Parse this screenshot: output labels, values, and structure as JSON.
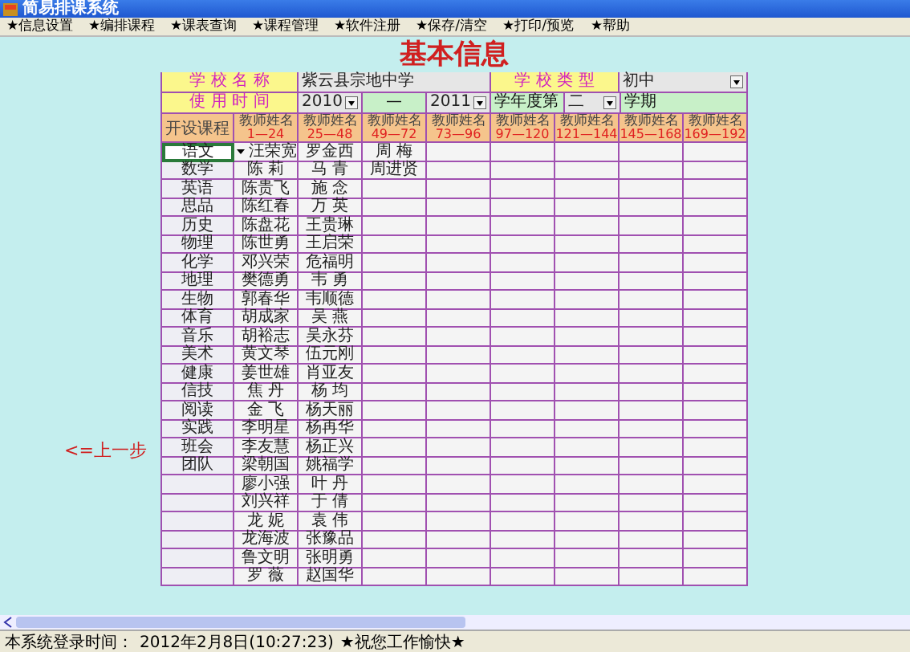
{
  "window": {
    "title": "简易排课系统"
  },
  "menu": [
    "★信息设置",
    "★编排课程",
    "★课表查询",
    "★课程管理",
    "★软件注册",
    "★保存/清空",
    "★打印/预览",
    "★帮助"
  ],
  "heading": "基本信息",
  "school": {
    "name_label": "学 校 名 称",
    "name": "紫云县宗地中学",
    "type_label": "学 校 类 型",
    "type": "初中"
  },
  "period": {
    "label": "使用时间",
    "start_year": "2010",
    "dash": "—",
    "end_year": "2011",
    "term_prefix": "学年度第",
    "term": "二",
    "term_suffix": "学期"
  },
  "table": {
    "subject_header": "开设课程",
    "columns": [
      {
        "label": "教师姓名",
        "range": "1—24"
      },
      {
        "label": "教师姓名",
        "range": "25—48"
      },
      {
        "label": "教师姓名",
        "range": "49—72"
      },
      {
        "label": "教师姓名",
        "range": "73—96"
      },
      {
        "label": "教师姓名",
        "range": "97—120"
      },
      {
        "label": "教师姓名",
        "range": "121—144"
      },
      {
        "label": "教师姓名",
        "range": "145—168"
      },
      {
        "label": "教师姓名",
        "range": "169—192"
      }
    ],
    "rows": [
      {
        "subject": "语文",
        "teachers": [
          "汪荣宽",
          "罗金西",
          "周 梅"
        ],
        "selected": true
      },
      {
        "subject": "数学",
        "teachers": [
          "陈 莉",
          "马 青",
          "周进贤"
        ],
        "selected": false
      },
      {
        "subject": "英语",
        "teachers": [
          "陈贵飞",
          "施 念"
        ],
        "selected": false
      },
      {
        "subject": "思品",
        "teachers": [
          "陈红春",
          "万 英"
        ],
        "selected": false
      },
      {
        "subject": "历史",
        "teachers": [
          "陈盘花",
          "王贵琳"
        ],
        "selected": false
      },
      {
        "subject": "物理",
        "teachers": [
          "陈世勇",
          "王启荣"
        ],
        "selected": false
      },
      {
        "subject": "化学",
        "teachers": [
          "邓兴荣",
          "危福明"
        ],
        "selected": false
      },
      {
        "subject": "地理",
        "teachers": [
          "樊德勇",
          "韦 勇"
        ],
        "selected": false
      },
      {
        "subject": "生物",
        "teachers": [
          "郭春华",
          "韦顺德"
        ],
        "selected": false
      },
      {
        "subject": "体育",
        "teachers": [
          "胡成家",
          "吴 燕"
        ],
        "selected": false
      },
      {
        "subject": "音乐",
        "teachers": [
          "胡裕志",
          "吴永芬"
        ],
        "selected": false
      },
      {
        "subject": "美术",
        "teachers": [
          "黄文琴",
          "伍元刚"
        ],
        "selected": false
      },
      {
        "subject": "健康",
        "teachers": [
          "姜世雄",
          "肖亚友"
        ],
        "selected": false
      },
      {
        "subject": "信技",
        "teachers": [
          "焦 丹",
          "杨 均"
        ],
        "selected": false
      },
      {
        "subject": "阅读",
        "teachers": [
          "金 飞",
          "杨天丽"
        ],
        "selected": false
      },
      {
        "subject": "实践",
        "teachers": [
          "李明星",
          "杨再华"
        ],
        "selected": false
      },
      {
        "subject": "班会",
        "teachers": [
          "李友慧",
          "杨正兴"
        ],
        "selected": false
      },
      {
        "subject": "团队",
        "teachers": [
          "梁朝国",
          "姚福学"
        ],
        "selected": false
      },
      {
        "subject": "",
        "teachers": [
          "廖小强",
          "叶 丹"
        ],
        "selected": false
      },
      {
        "subject": "",
        "teachers": [
          "刘兴祥",
          "于 倩"
        ],
        "selected": false
      },
      {
        "subject": "",
        "teachers": [
          "龙 妮",
          "袁 伟"
        ],
        "selected": false
      },
      {
        "subject": "",
        "teachers": [
          "龙海波",
          "张豫品"
        ],
        "selected": false
      },
      {
        "subject": "",
        "teachers": [
          "鲁文明",
          "张明勇"
        ],
        "selected": false
      },
      {
        "subject": "",
        "teachers": [
          "罗 薇",
          "赵国华"
        ],
        "selected": false
      }
    ]
  },
  "back_link": "<=上一步",
  "status_bar": {
    "label": "本系统登录时间：",
    "time": "2012年2月8日(10:27:23)",
    "greeting": "★祝您工作愉快★"
  }
}
